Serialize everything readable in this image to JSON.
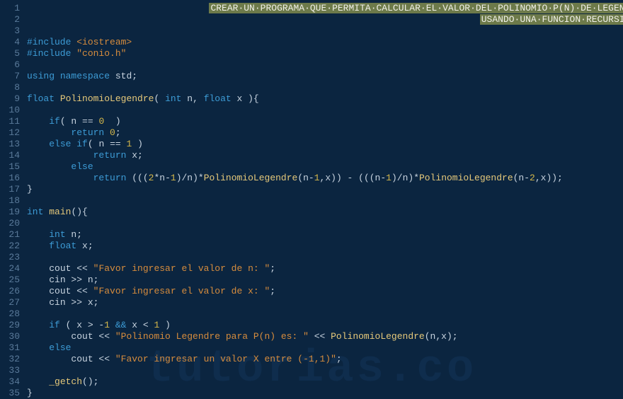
{
  "watermark": "tutorias.co",
  "lines": [
    {
      "n": 1,
      "tokens": [
        {
          "type": "ws",
          "t": "                                 "
        },
        {
          "type": "hlcmt",
          "t": "CREAR·UN·PROGRAMA·QUE·PERMITA·CALCULAR·EL·VALOR·DEL·POLINOMIO·P(N)·DE·LEGENDRE"
        }
      ]
    },
    {
      "n": 2,
      "tokens": [
        {
          "type": "ws",
          "t": "                                                                                  "
        },
        {
          "type": "hlcmt",
          "t": "USANDO·UNA·FUNCION·RECURSIVA"
        }
      ]
    },
    {
      "n": 3,
      "tokens": []
    },
    {
      "n": 4,
      "tokens": [
        {
          "type": "pp",
          "t": "#include "
        },
        {
          "type": "st",
          "t": "<iostream>"
        }
      ]
    },
    {
      "n": 5,
      "tokens": [
        {
          "type": "pp",
          "t": "#include "
        },
        {
          "type": "st",
          "t": "\"conio.h\""
        }
      ]
    },
    {
      "n": 6,
      "tokens": []
    },
    {
      "n": 7,
      "tokens": [
        {
          "type": "kw",
          "t": "using"
        },
        {
          "type": "tx",
          "t": " "
        },
        {
          "type": "kw",
          "t": "namespace"
        },
        {
          "type": "tx",
          "t": " std;"
        }
      ]
    },
    {
      "n": 8,
      "tokens": []
    },
    {
      "n": 9,
      "tokens": [
        {
          "type": "kw",
          "t": "float"
        },
        {
          "type": "tx",
          "t": " "
        },
        {
          "type": "fn",
          "t": "PolinomioLegendre"
        },
        {
          "type": "tx",
          "t": "( "
        },
        {
          "type": "kw",
          "t": "int"
        },
        {
          "type": "tx",
          "t": " n, "
        },
        {
          "type": "kw",
          "t": "float"
        },
        {
          "type": "tx",
          "t": " x ){"
        }
      ]
    },
    {
      "n": 10,
      "tokens": []
    },
    {
      "n": 11,
      "tokens": [
        {
          "type": "ws",
          "t": "    "
        },
        {
          "type": "kw",
          "t": "if"
        },
        {
          "type": "tx",
          "t": "( n == "
        },
        {
          "type": "nm",
          "t": "0"
        },
        {
          "type": "tx",
          "t": "  )"
        }
      ]
    },
    {
      "n": 12,
      "tokens": [
        {
          "type": "ws",
          "t": "        "
        },
        {
          "type": "kw",
          "t": "return"
        },
        {
          "type": "tx",
          "t": " "
        },
        {
          "type": "nm",
          "t": "0"
        },
        {
          "type": "tx",
          "t": ";"
        }
      ]
    },
    {
      "n": 13,
      "tokens": [
        {
          "type": "ws",
          "t": "    "
        },
        {
          "type": "kw",
          "t": "else"
        },
        {
          "type": "tx",
          "t": " "
        },
        {
          "type": "kw",
          "t": "if"
        },
        {
          "type": "tx",
          "t": "( n == "
        },
        {
          "type": "nm",
          "t": "1"
        },
        {
          "type": "tx",
          "t": " )"
        }
      ]
    },
    {
      "n": 14,
      "tokens": [
        {
          "type": "ws",
          "t": "            "
        },
        {
          "type": "kw",
          "t": "return"
        },
        {
          "type": "tx",
          "t": " x;"
        }
      ]
    },
    {
      "n": 15,
      "tokens": [
        {
          "type": "ws",
          "t": "        "
        },
        {
          "type": "kw",
          "t": "else"
        }
      ]
    },
    {
      "n": 16,
      "tokens": [
        {
          "type": "ws",
          "t": "            "
        },
        {
          "type": "kw",
          "t": "return"
        },
        {
          "type": "tx",
          "t": " ((("
        },
        {
          "type": "nm",
          "t": "2"
        },
        {
          "type": "tx",
          "t": "*n-"
        },
        {
          "type": "nm",
          "t": "1"
        },
        {
          "type": "tx",
          "t": ")/n)*"
        },
        {
          "type": "fn",
          "t": "PolinomioLegendre"
        },
        {
          "type": "tx",
          "t": "(n-"
        },
        {
          "type": "nm",
          "t": "1"
        },
        {
          "type": "tx",
          "t": ",x)) - (((n-"
        },
        {
          "type": "nm",
          "t": "1"
        },
        {
          "type": "tx",
          "t": ")/n)*"
        },
        {
          "type": "fn",
          "t": "PolinomioLegendre"
        },
        {
          "type": "tx",
          "t": "(n-"
        },
        {
          "type": "nm",
          "t": "2"
        },
        {
          "type": "tx",
          "t": ",x));"
        }
      ]
    },
    {
      "n": 17,
      "tokens": [
        {
          "type": "tx",
          "t": "}"
        }
      ]
    },
    {
      "n": 18,
      "tokens": []
    },
    {
      "n": 19,
      "tokens": [
        {
          "type": "kw",
          "t": "int"
        },
        {
          "type": "tx",
          "t": " "
        },
        {
          "type": "fn",
          "t": "main"
        },
        {
          "type": "tx",
          "t": "(){"
        }
      ]
    },
    {
      "n": 20,
      "tokens": []
    },
    {
      "n": 21,
      "tokens": [
        {
          "type": "ws",
          "t": "    "
        },
        {
          "type": "kw",
          "t": "int"
        },
        {
          "type": "tx",
          "t": " n;"
        }
      ]
    },
    {
      "n": 22,
      "tokens": [
        {
          "type": "ws",
          "t": "    "
        },
        {
          "type": "kw",
          "t": "float"
        },
        {
          "type": "tx",
          "t": " x;"
        }
      ]
    },
    {
      "n": 23,
      "tokens": []
    },
    {
      "n": 24,
      "tokens": [
        {
          "type": "ws",
          "t": "    "
        },
        {
          "type": "tx",
          "t": "cout << "
        },
        {
          "type": "st",
          "t": "\"Favor ingresar el valor de n: \""
        },
        {
          "type": "tx",
          "t": ";"
        }
      ]
    },
    {
      "n": 25,
      "tokens": [
        {
          "type": "ws",
          "t": "    "
        },
        {
          "type": "tx",
          "t": "cin >> n;"
        }
      ]
    },
    {
      "n": 26,
      "tokens": [
        {
          "type": "ws",
          "t": "    "
        },
        {
          "type": "tx",
          "t": "cout << "
        },
        {
          "type": "st",
          "t": "\"Favor ingresar el valor de x: \""
        },
        {
          "type": "tx",
          "t": ";"
        }
      ]
    },
    {
      "n": 27,
      "tokens": [
        {
          "type": "ws",
          "t": "    "
        },
        {
          "type": "tx",
          "t": "cin >> x;"
        }
      ]
    },
    {
      "n": 28,
      "tokens": []
    },
    {
      "n": 29,
      "tokens": [
        {
          "type": "ws",
          "t": "    "
        },
        {
          "type": "kw",
          "t": "if"
        },
        {
          "type": "tx",
          "t": " ( x > -"
        },
        {
          "type": "nm",
          "t": "1"
        },
        {
          "type": "tx",
          "t": " "
        },
        {
          "type": "kw",
          "t": "&&"
        },
        {
          "type": "tx",
          "t": " x < "
        },
        {
          "type": "nm",
          "t": "1"
        },
        {
          "type": "tx",
          "t": " )"
        }
      ]
    },
    {
      "n": 30,
      "tokens": [
        {
          "type": "ws",
          "t": "        "
        },
        {
          "type": "tx",
          "t": "cout << "
        },
        {
          "type": "st",
          "t": "\"Polinomio Legendre para P(n) es: \""
        },
        {
          "type": "tx",
          "t": " << "
        },
        {
          "type": "fn",
          "t": "PolinomioLegendre"
        },
        {
          "type": "tx",
          "t": "(n,x);"
        }
      ]
    },
    {
      "n": 31,
      "tokens": [
        {
          "type": "ws",
          "t": "    "
        },
        {
          "type": "kw",
          "t": "else"
        }
      ]
    },
    {
      "n": 32,
      "tokens": [
        {
          "type": "ws",
          "t": "        "
        },
        {
          "type": "tx",
          "t": "cout << "
        },
        {
          "type": "st",
          "t": "\"Favor ingresar un valor X entre (-1,1)\""
        },
        {
          "type": "tx",
          "t": ";"
        }
      ]
    },
    {
      "n": 33,
      "tokens": []
    },
    {
      "n": 34,
      "tokens": [
        {
          "type": "ws",
          "t": "    "
        },
        {
          "type": "fn",
          "t": "_getch"
        },
        {
          "type": "tx",
          "t": "();"
        }
      ]
    },
    {
      "n": 35,
      "tokens": [
        {
          "type": "tx",
          "t": "}"
        }
      ]
    }
  ]
}
